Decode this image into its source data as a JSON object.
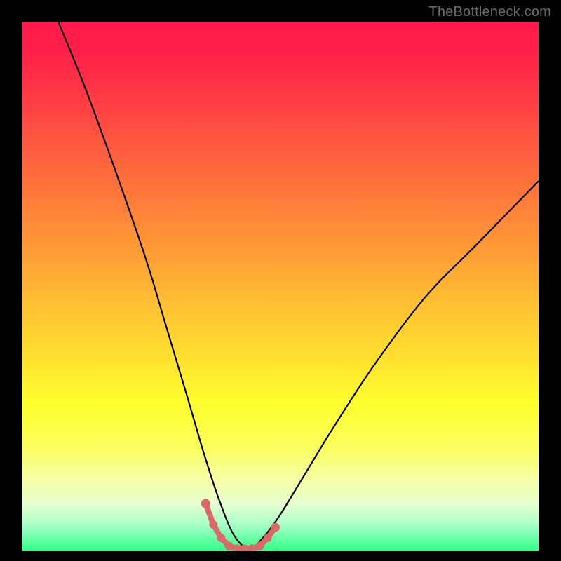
{
  "watermark": "TheBottleneck.com",
  "colors": {
    "gradient_top": "#ff1a4c",
    "gradient_mid": "#ffff2e",
    "gradient_bottom": "#2eff88",
    "curve": "#000000",
    "marker": "#d86a6a",
    "background": "#000000"
  },
  "chart_data": {
    "type": "line",
    "title": "",
    "xlabel": "",
    "ylabel": "",
    "xlim": [
      0,
      100
    ],
    "ylim": [
      0,
      100
    ],
    "notes": "V-shaped bottleneck curve over rainbow gradient background; minimum near x≈42, y≈0. Left branch starts near top-left; right branch rises to ~y≈70 at x=100. Pink markers cluster at and around the valley floor.",
    "series": [
      {
        "name": "bottleneck-curve",
        "x": [
          7,
          12,
          18,
          24,
          28,
          32,
          35,
          38,
          41,
          44,
          47,
          50,
          55,
          60,
          68,
          78,
          88,
          100
        ],
        "y": [
          100,
          88,
          72,
          55,
          42,
          29,
          19,
          10,
          3,
          0.5,
          3,
          7,
          15,
          23,
          35,
          48,
          58,
          70
        ]
      }
    ],
    "markers": [
      {
        "x": 35.5,
        "y": 9.0
      },
      {
        "x": 37.0,
        "y": 5.0
      },
      {
        "x": 38.5,
        "y": 2.5
      },
      {
        "x": 40.0,
        "y": 1.0
      },
      {
        "x": 41.5,
        "y": 0.5
      },
      {
        "x": 43.0,
        "y": 0.5
      },
      {
        "x": 44.5,
        "y": 0.5
      },
      {
        "x": 46.0,
        "y": 1.0
      },
      {
        "x": 47.5,
        "y": 2.5
      },
      {
        "x": 49.0,
        "y": 4.5
      }
    ]
  }
}
